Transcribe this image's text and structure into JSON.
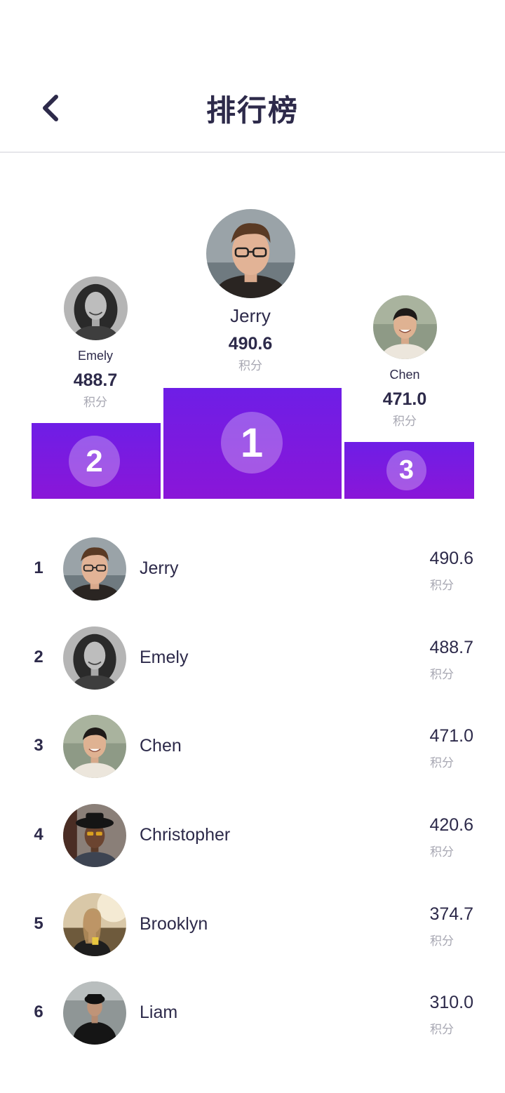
{
  "header": {
    "title": "排行榜",
    "back_icon": "chevron-left-icon"
  },
  "podium": {
    "first": {
      "rank": "1",
      "name": "Jerry",
      "score": "490.6",
      "unit": "积分"
    },
    "second": {
      "rank": "2",
      "name": "Emely",
      "score": "488.7",
      "unit": "积分"
    },
    "third": {
      "rank": "3",
      "name": "Chen",
      "score": "471.0",
      "unit": "积分"
    }
  },
  "ranking": [
    {
      "rank": "1",
      "name": "Jerry",
      "score": "490.6",
      "unit": "积分"
    },
    {
      "rank": "2",
      "name": "Emely",
      "score": "488.7",
      "unit": "积分"
    },
    {
      "rank": "3",
      "name": "Chen",
      "score": "471.0",
      "unit": "积分"
    },
    {
      "rank": "4",
      "name": "Christopher",
      "score": "420.6",
      "unit": "积分"
    },
    {
      "rank": "5",
      "name": "Brooklyn",
      "score": "374.7",
      "unit": "积分"
    },
    {
      "rank": "6",
      "name": "Liam",
      "score": "310.0",
      "unit": "积分"
    }
  ],
  "colors": {
    "accent_top": "#6e1ee6",
    "accent_bottom": "#8a16d8",
    "text_primary": "#2d2a4a",
    "text_muted": "#a8a8b3"
  }
}
